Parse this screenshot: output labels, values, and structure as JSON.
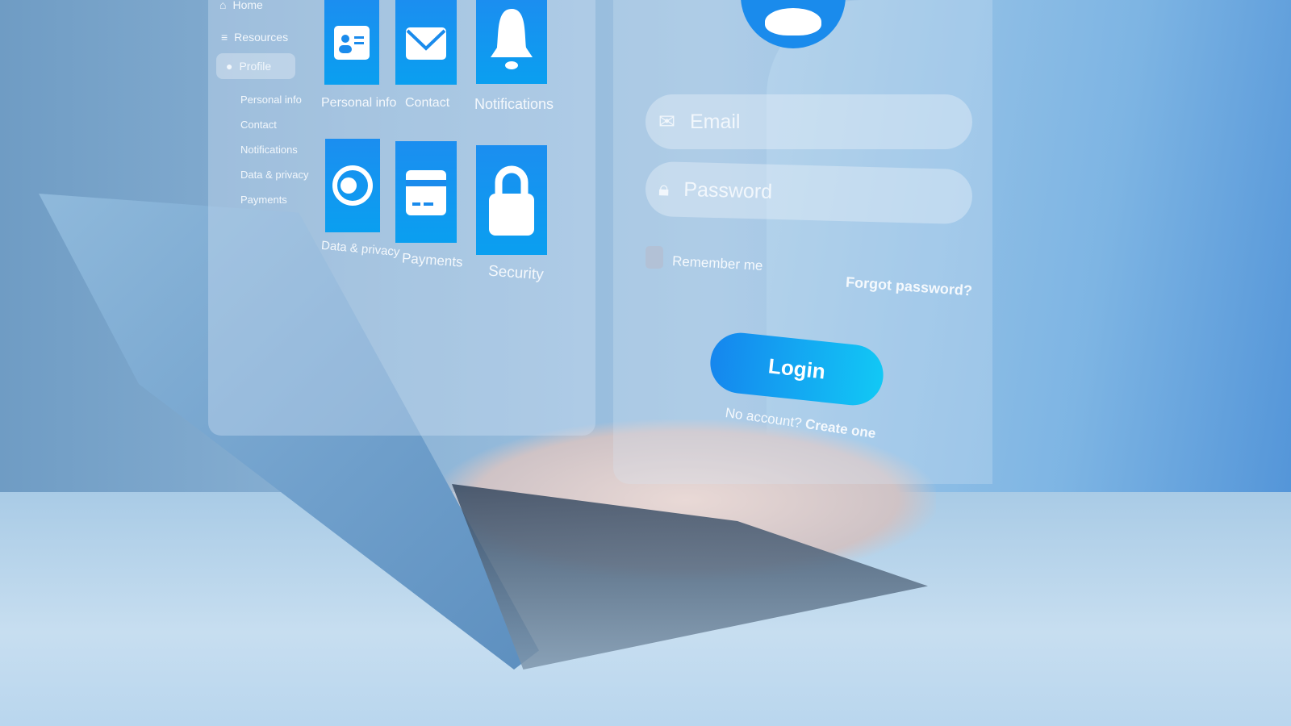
{
  "sidebar": {
    "items": [
      {
        "label": "Home",
        "icon": "home-icon"
      },
      {
        "label": "Resources",
        "icon": "database-icon"
      },
      {
        "label": "Profile",
        "icon": "user-icon",
        "active": true
      }
    ],
    "sub_items": [
      "Personal info",
      "Contact",
      "Notifications",
      "Data & privacy",
      "Payments"
    ]
  },
  "tiles": [
    {
      "label": "Personal info",
      "icon": "id-card-icon"
    },
    {
      "label": "Contact",
      "icon": "envelope-icon"
    },
    {
      "label": "Notifications",
      "icon": "bell-icon"
    },
    {
      "label": "Data & privacy",
      "icon": "toggle-icon"
    },
    {
      "label": "Payments",
      "icon": "credit-card-icon"
    },
    {
      "label": "Security",
      "icon": "lock-icon"
    }
  ],
  "login": {
    "email_placeholder": "Email",
    "password_placeholder": "Password",
    "remember": "Remember me",
    "forgot": "Forgot password?",
    "button": "Login",
    "no_account": "No account?",
    "create": "Create one"
  },
  "colors": {
    "accent": "#1a8bec",
    "accent_end": "#12c8f5"
  }
}
